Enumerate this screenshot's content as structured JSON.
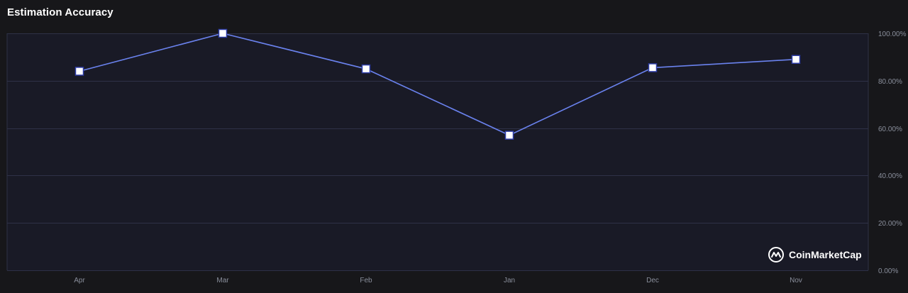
{
  "widget": {
    "title": "Estimation Accuracy",
    "brand": "CoinMarketCap"
  },
  "colors": {
    "background": "#17171a",
    "plot_background": "#191a26",
    "grid": "#2e3147",
    "line": "#6a82ee",
    "marker_fill": "#ffffff",
    "marker_stroke": "#2f3ea8"
  },
  "chart_data": {
    "type": "line",
    "title": "Estimation Accuracy",
    "xlabel": "",
    "ylabel": "",
    "categories": [
      "Apr",
      "Mar",
      "Feb",
      "Jan",
      "Dec",
      "Nov"
    ],
    "series": [
      {
        "values": [
          84.0,
          100.0,
          85.0,
          57.0,
          85.5,
          89.0
        ]
      }
    ],
    "ylim": [
      0,
      100
    ],
    "y_ticks": [
      "0.00%",
      "20.00%",
      "40.00%",
      "60.00%",
      "80.00%",
      "100.00%"
    ],
    "y_axis_position": "right",
    "grid": true,
    "legend": "none"
  }
}
